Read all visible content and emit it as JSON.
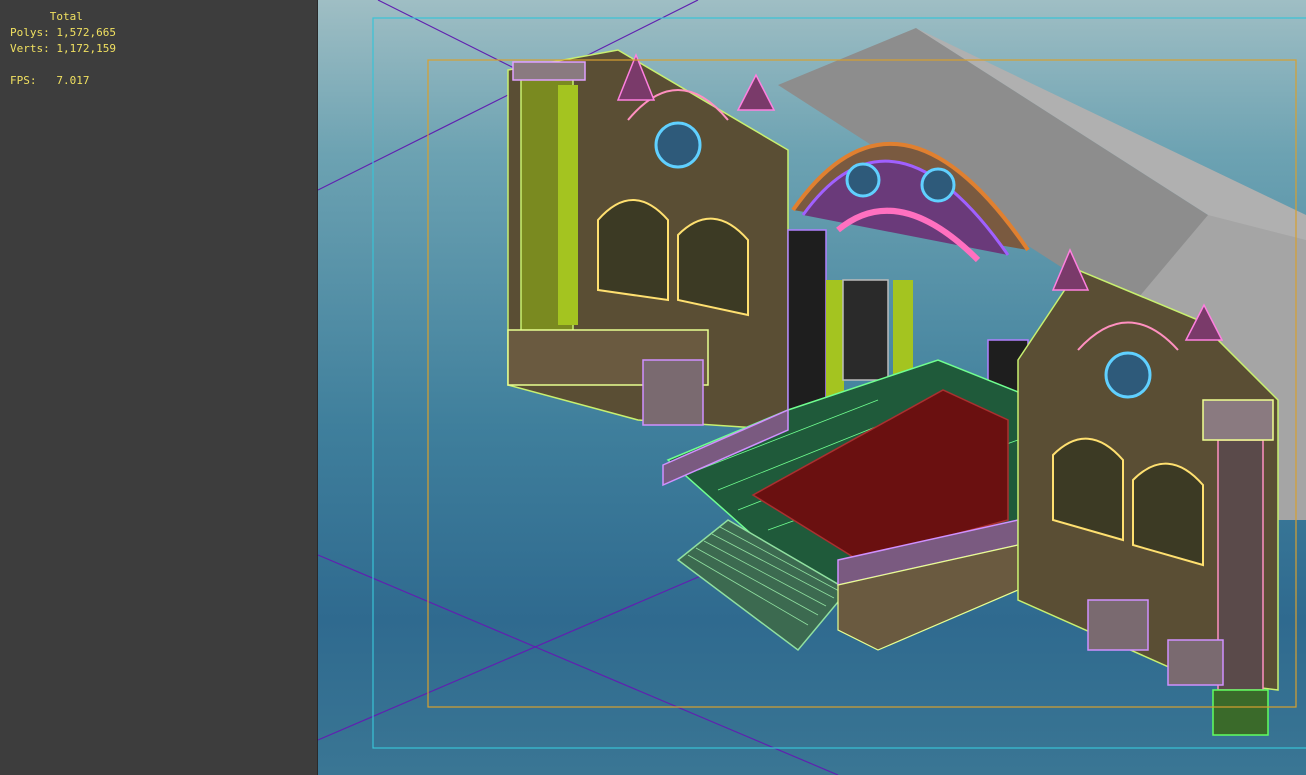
{
  "stats": {
    "header": "Total",
    "polys_label": "Polys:",
    "polys_value": "1,572,665",
    "verts_label": "Verts:",
    "verts_value": "1,172,159",
    "fps_label": "FPS:",
    "fps_value": "7.017"
  },
  "colors": {
    "panel_bg": "#3d3d3d",
    "stats_text": "#f0e060",
    "safe_frame_outer": "#39c3d6",
    "safe_frame_inner": "#d7a030",
    "wireframe_green": "#9fe94e",
    "wireframe_purple": "#a070f0",
    "carpet": "#6a1010",
    "box_gray": "#8b8b8b"
  },
  "viewport": {
    "label": "3d-viewport",
    "scene": "gothic-cathedral-facade-wireframe"
  }
}
